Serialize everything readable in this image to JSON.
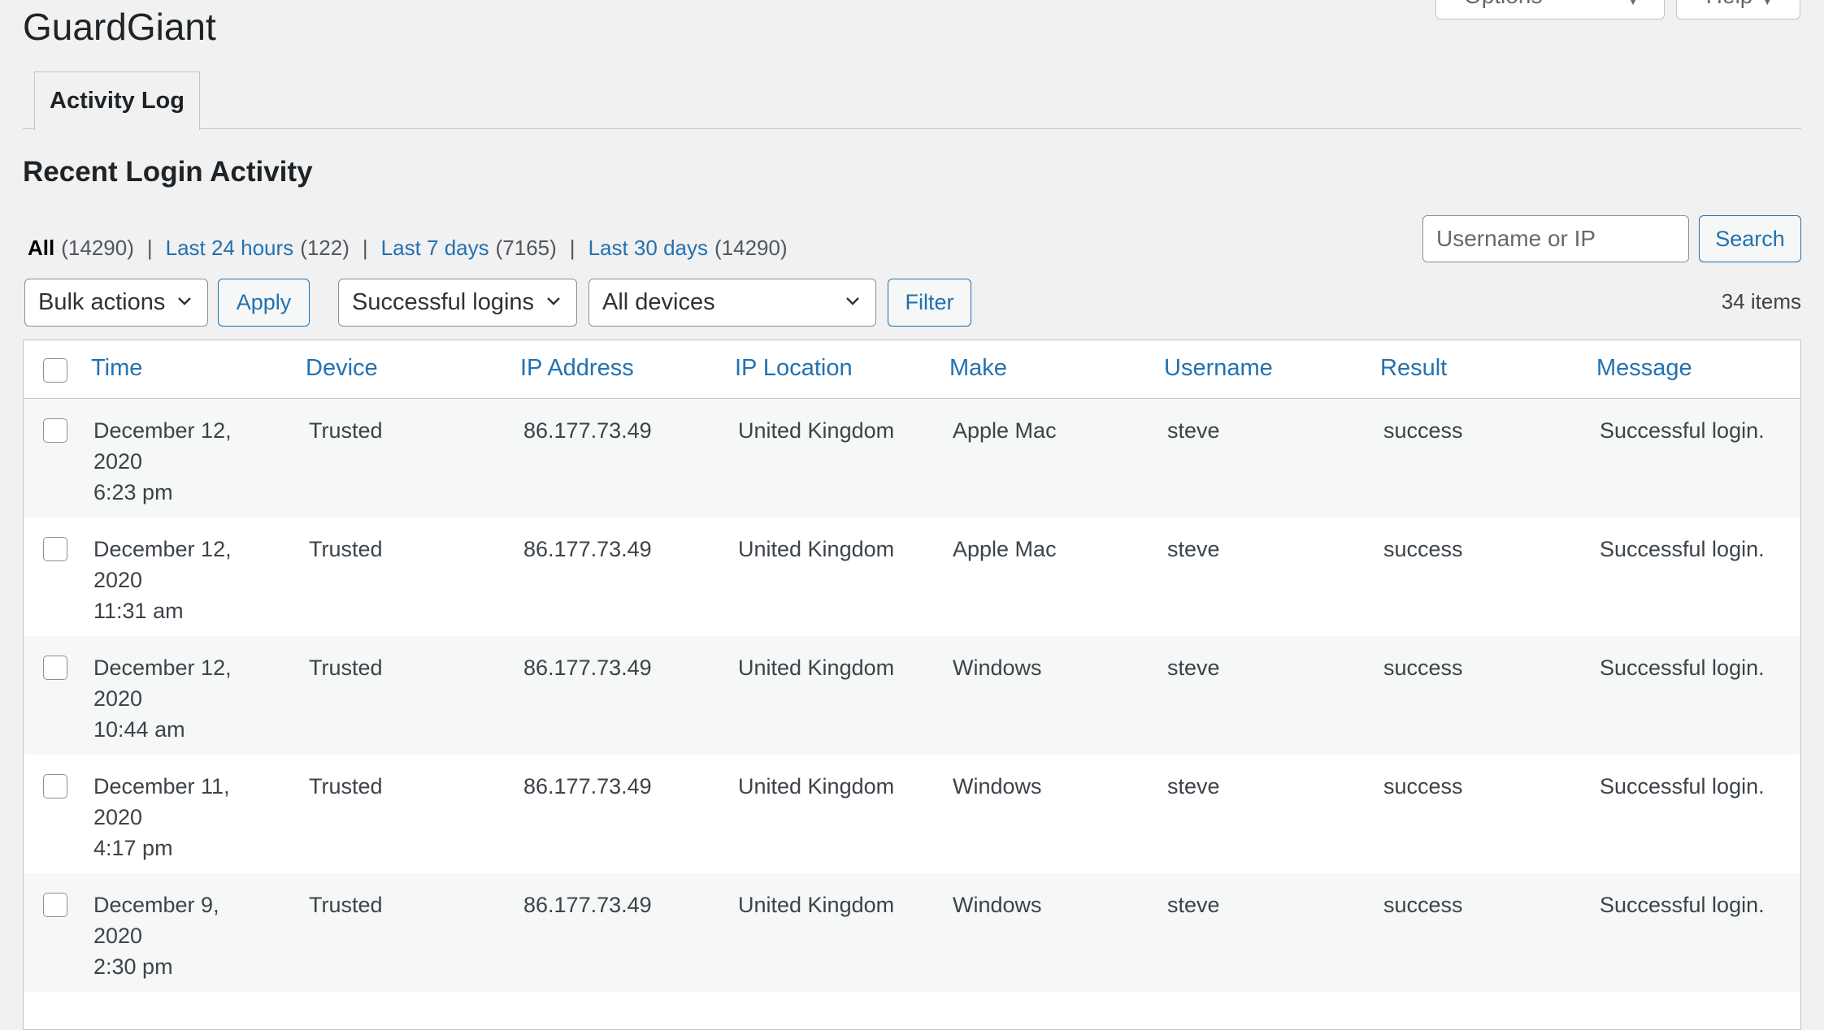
{
  "screen_meta": {
    "screen_options_label": "Screen Options",
    "help_label": "Help"
  },
  "page_title": "GuardGiant",
  "tabs": [
    {
      "label": "Activity Log",
      "active": true
    }
  ],
  "section_title": "Recent Login Activity",
  "views": [
    {
      "label": "All",
      "count": "(14290)",
      "current": true
    },
    {
      "label": "Last 24 hours",
      "count": "(122)",
      "current": false
    },
    {
      "label": "Last 7 days",
      "count": "(7165)",
      "current": false
    },
    {
      "label": "Last 30 days",
      "count": "(14290)",
      "current": false
    }
  ],
  "search": {
    "placeholder": "Username or IP",
    "value": "",
    "button_label": "Search"
  },
  "tablenav": {
    "bulk_actions": "Bulk actions",
    "apply_label": "Apply",
    "login_type": "Successful logins",
    "device_type": "All devices",
    "filter_label": "Filter",
    "items_count": "34 items"
  },
  "table": {
    "columns": [
      "Time",
      "Device",
      "IP Address",
      "IP Location",
      "Make",
      "Username",
      "Result",
      "Message"
    ],
    "rows": [
      {
        "date": "December 12,",
        "year": "2020",
        "time": "6:23 pm",
        "device": "Trusted",
        "ip": "86.177.73.49",
        "location": "United Kingdom",
        "make": "Apple Mac",
        "username": "steve",
        "result": "success",
        "message": "Successful login."
      },
      {
        "date": "December 12,",
        "year": "2020",
        "time": "11:31 am",
        "device": "Trusted",
        "ip": "86.177.73.49",
        "location": "United Kingdom",
        "make": "Apple Mac",
        "username": "steve",
        "result": "success",
        "message": "Successful login."
      },
      {
        "date": "December 12,",
        "year": "2020",
        "time": "10:44 am",
        "device": "Trusted",
        "ip": "86.177.73.49",
        "location": "United Kingdom",
        "make": "Windows",
        "username": "steve",
        "result": "success",
        "message": "Successful login."
      },
      {
        "date": "December 11,",
        "year": "2020",
        "time": "4:17 pm",
        "device": "Trusted",
        "ip": "86.177.73.49",
        "location": "United Kingdom",
        "make": "Windows",
        "username": "steve",
        "result": "success",
        "message": "Successful login."
      },
      {
        "date": "December 9,",
        "year": "2020",
        "time": "2:30 pm",
        "device": "Trusted",
        "ip": "86.177.73.49",
        "location": "United Kingdom",
        "make": "Windows",
        "username": "steve",
        "result": "success",
        "message": "Successful login."
      }
    ]
  }
}
